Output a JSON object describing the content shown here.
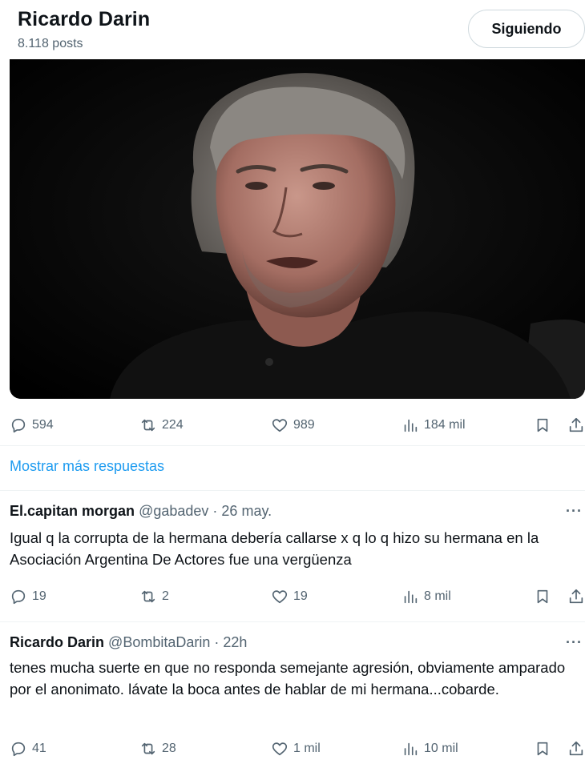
{
  "profile": {
    "name": "Ricardo Darin",
    "posts": "8.118 posts",
    "follow_label": "Siguiendo"
  },
  "main_post": {
    "media_alt": "Retrato de un hombre de cabello canoso con remera negra sobre fondo oscuro",
    "stats": {
      "replies": "594",
      "reposts": "224",
      "likes": "989",
      "views": "184 mil"
    }
  },
  "more_replies_label": "Mostrar más respuestas",
  "replies": [
    {
      "name": "El.capitan morgan",
      "handle": "@gabadev",
      "time": "26 may.",
      "text": "Igual q la corrupta de la hermana debería callarse x q lo q hizo su hermana en la Asociación Argentina De Actores fue una vergüenza",
      "stats": {
        "replies": "19",
        "reposts": "2",
        "likes": "19",
        "views": "8 mil"
      }
    },
    {
      "name": "Ricardo Darin",
      "handle": "@BombitaDarin",
      "time": "22h",
      "text": "tenes mucha suerte en que no responda semejante agresión, obviamente amparado por el anonimato. lávate la boca antes de hablar de mi hermana...cobarde.",
      "stats": {
        "replies": "41",
        "reposts": "28",
        "likes": "1 mil",
        "views": "10 mil"
      }
    }
  ],
  "icons": [
    "reply-icon",
    "repost-icon",
    "like-icon",
    "views-icon",
    "bookmark-icon",
    "share-icon",
    "more-icon"
  ],
  "colors": {
    "link": "#1d9bf0",
    "secondary": "#536471"
  }
}
